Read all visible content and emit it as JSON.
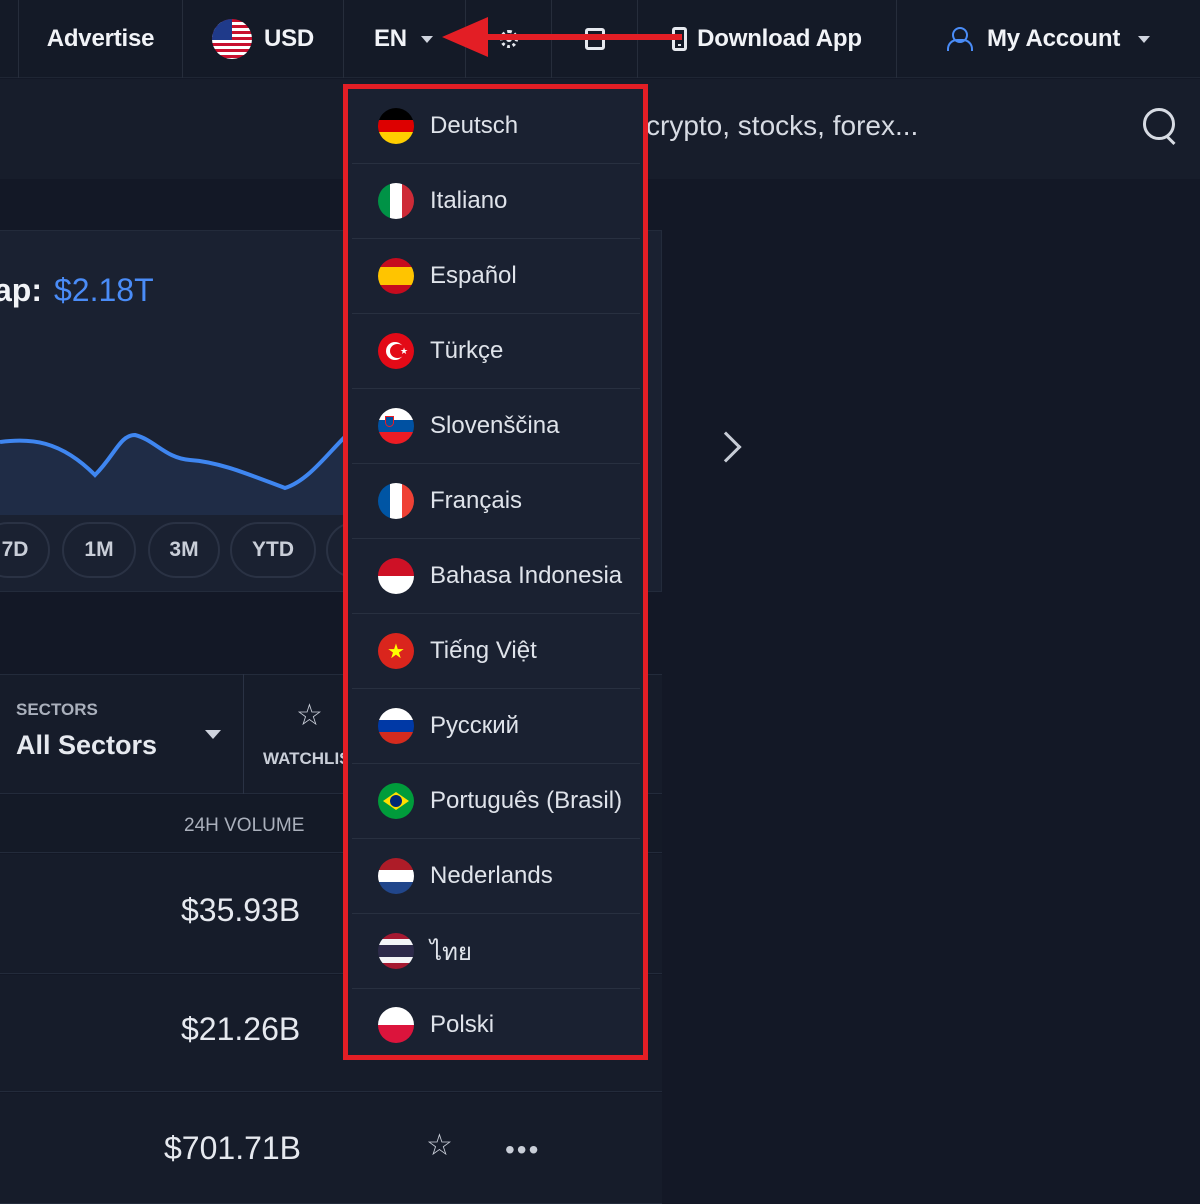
{
  "topbar": {
    "advertise": "Advertise",
    "currency": "USD",
    "language": "EN",
    "download_app": "Download App",
    "my_account": "My Account"
  },
  "search": {
    "placeholder": "crypto, stocks, forex..."
  },
  "market": {
    "cap_label": "ap:",
    "cap_value": "$2.18T"
  },
  "ranges": [
    "7D",
    "1M",
    "3M",
    "YTD"
  ],
  "filters": {
    "sectors_caption": "SECTORS",
    "sectors_value": "All Sectors",
    "watchlist": "WATCHLIST"
  },
  "table": {
    "volume_header": "24H VOLUME",
    "volumes": [
      "$35.93B",
      "$21.26B",
      "$701.71B"
    ]
  },
  "languages": [
    {
      "label": "Deutsch",
      "flag": "de"
    },
    {
      "label": "Italiano",
      "flag": "it"
    },
    {
      "label": "Español",
      "flag": "es"
    },
    {
      "label": "Türkçe",
      "flag": "tr"
    },
    {
      "label": "Slovenščina",
      "flag": "si"
    },
    {
      "label": "Français",
      "flag": "fr"
    },
    {
      "label": "Bahasa Indonesia",
      "flag": "id"
    },
    {
      "label": "Tiếng Việt",
      "flag": "vn"
    },
    {
      "label": "Русский",
      "flag": "ru"
    },
    {
      "label": "Português (Brasil)",
      "flag": "br"
    },
    {
      "label": "Nederlands",
      "flag": "nl"
    },
    {
      "label": "ไทย",
      "flag": "th"
    },
    {
      "label": "Polski",
      "flag": "pl"
    }
  ],
  "colors": {
    "accent": "#4a8cf7",
    "highlight": "#e31e25",
    "background": "#131826"
  }
}
